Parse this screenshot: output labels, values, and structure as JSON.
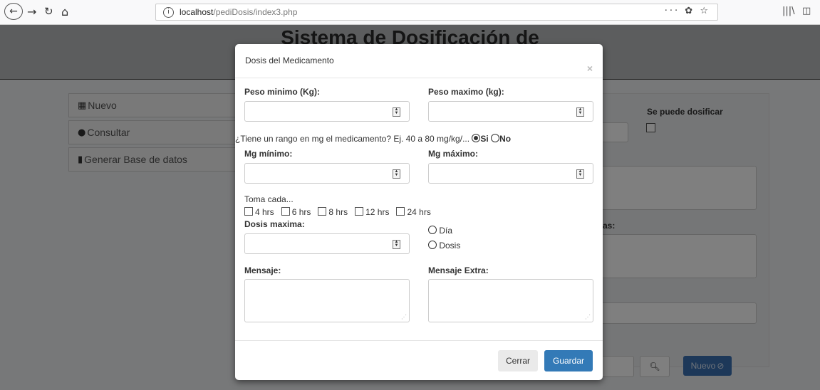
{
  "browser": {
    "url_host": "localhost",
    "url_path": "/pediDosis/index3.php",
    "url_right_icons": "··· ✿ ☆"
  },
  "page": {
    "title": "Sistema de Dosificación de"
  },
  "sidebar": {
    "items": [
      {
        "label": "Nuevo",
        "icon": "grid-icon"
      },
      {
        "label": "Consultar",
        "icon": "user-icon"
      },
      {
        "label": "Generar Base de datos",
        "icon": "file-icon"
      }
    ]
  },
  "background_form": {
    "dosificar_label": "Se puede dosificar",
    "partial_label_1": "as:",
    "search_button": "",
    "nuevo_button": "Nuevo"
  },
  "modal": {
    "title": "Dosis del Medicamento",
    "close": "×",
    "peso_min_label": "Peso minimo (Kg):",
    "peso_max_label": "Peso maximo (kg):",
    "rango_question": "¿Tiene un rango en mg el medicamento? Ej. 40 a 80 mg/kg/...",
    "rango_si": "Si",
    "rango_no": "No",
    "rango_selected": "Si",
    "mg_min_label": "Mg mínimo:",
    "mg_max_label": "Mg máximo:",
    "toma_label": "Toma cada...",
    "toma_options": [
      "4 hrs",
      "6 hrs",
      "8 hrs",
      "12 hrs",
      "24 hrs"
    ],
    "dosis_max_label": "Dosis maxima:",
    "dosis_options": [
      "Día",
      "Dosis"
    ],
    "mensaje_label": "Mensaje:",
    "mensaje_extra_label": "Mensaje Extra:",
    "cerrar_button": "Cerrar",
    "guardar_button": "Guardar"
  },
  "colors": {
    "primary": "#337ab7",
    "header_bg": "#b9bbbd"
  }
}
